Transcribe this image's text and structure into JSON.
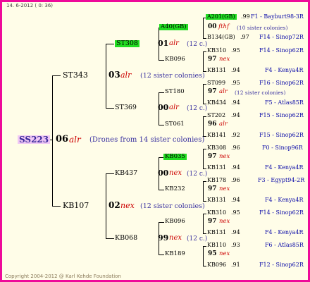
{
  "header": {
    "date_label": "14.  6-2012 (  0: 36)"
  },
  "footer": {
    "copyright": "Copyright 2004-2012 @ Karl Kehde Foundation"
  },
  "colors": {
    "border": "#ee0a9a",
    "background": "#fffde8",
    "race": "#cc0000",
    "comment": "#3a32a0",
    "location": "#0b0ba8",
    "highlight_green": "#22dd22",
    "highlight_pink": "#f0c8f5"
  },
  "root": {
    "name": "SS223",
    "year": "06",
    "race": "alr",
    "comment": "(Drones from 14 sister colonies)"
  },
  "gen1": {
    "sire": {
      "name": "ST343",
      "year": "03",
      "race": "alr",
      "comment": "(12 sister colonies)"
    },
    "dam": {
      "name": "KB107",
      "year": "02",
      "race": "nex",
      "comment": "(12 sister colonies)"
    }
  },
  "gen2": [
    {
      "name": "ST308",
      "year": "01",
      "race": "alr",
      "comment": "(12 c.)"
    },
    {
      "name": "ST369",
      "year": "00",
      "race": "alr",
      "comment": "(12 c.)"
    },
    {
      "name": "KB437",
      "year": "00",
      "race": "nex",
      "comment": "(12 c.)"
    },
    {
      "name": "KB068",
      "year": "99",
      "race": "nex",
      "comment": "(12 c.)"
    }
  ],
  "gen3": [
    {
      "name": "A40(GB)",
      "year": "00",
      "race": "fthf",
      "comment": "(10 sister colonies)"
    },
    {
      "name": "KB096",
      "year": "97",
      "race": "nex",
      "comment": ""
    },
    {
      "name": "ST180",
      "year": "97",
      "race": "alr",
      "comment": "(12 sister colonies)"
    },
    {
      "name": "ST061",
      "year": "96",
      "race": "alr",
      "comment": ""
    },
    {
      "name": "KB035",
      "year": "97",
      "race": "nex",
      "comment": ""
    },
    {
      "name": "KB232",
      "year": "97",
      "race": "nex",
      "comment": ""
    },
    {
      "name": "KB096",
      "year": "97",
      "race": "nex",
      "comment": ""
    },
    {
      "name": "KB189",
      "year": "95",
      "race": "nex",
      "comment": ""
    }
  ],
  "gen4": [
    {
      "name": "A201(GB)",
      "year": ".99",
      "loc": "F1 - Bayburt98-3R"
    },
    {
      "name": "B134(GB)",
      "year": ".97",
      "loc": "F14 - Sinop72R"
    },
    {
      "name": "KB310",
      "year": ".95",
      "loc": "F14 - Sinop62R"
    },
    {
      "name": "KB131",
      "year": ".94",
      "loc": "F4 - Kenya4R"
    },
    {
      "name": "ST099",
      "year": ".95",
      "loc": "F16 - Sinop62R"
    },
    {
      "name": "KB434",
      "year": ".94",
      "loc": "F5 - Atlas85R"
    },
    {
      "name": "ST202",
      "year": ".94",
      "loc": "F15 - Sinop62R"
    },
    {
      "name": "KB141",
      "year": ".92",
      "loc": "F15 - Sinop62R"
    },
    {
      "name": "KB308",
      "year": ".96",
      "loc": "F0 - Sinop96R"
    },
    {
      "name": "KB131",
      "year": ".94",
      "loc": "F4 - Kenya4R"
    },
    {
      "name": "KB178",
      "year": ".96",
      "loc": "F3 - Egypt94-2R"
    },
    {
      "name": "KB131",
      "year": ".94",
      "loc": "F4 - Kenya4R"
    },
    {
      "name": "KB310",
      "year": ".95",
      "loc": "F14 - Sinop62R"
    },
    {
      "name": "KB131",
      "year": ".94",
      "loc": "F4 - Kenya4R"
    },
    {
      "name": "KB110",
      "year": ".93",
      "loc": "F6 - Atlas85R"
    },
    {
      "name": "KB096",
      "year": ".91",
      "loc": "F12 - Sinop62R"
    }
  ]
}
